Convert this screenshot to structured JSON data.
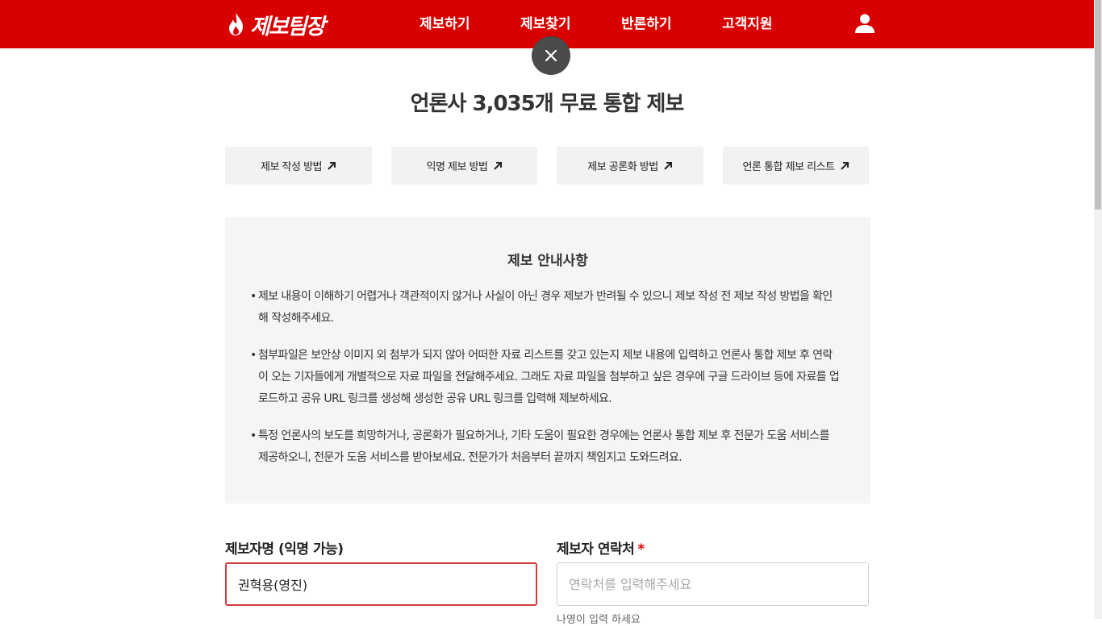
{
  "header": {
    "logo_text": "제보팀장",
    "nav": [
      "제보하기",
      "제보찾기",
      "반론하기",
      "고객지원"
    ],
    "brand_color": "#d90000"
  },
  "close_button": {
    "icon": "close-icon"
  },
  "page_title": "언론사 3,035개 무료 통합 제보",
  "guide_buttons": [
    {
      "label": "제보 작성 방법",
      "icon": "arrow-up-right-icon"
    },
    {
      "label": "익명 제보 방법",
      "icon": "arrow-up-right-icon"
    },
    {
      "label": "제보 공론화 방법",
      "icon": "arrow-up-right-icon"
    },
    {
      "label": "언론 통합 제보 리스트",
      "icon": "arrow-up-right-icon"
    }
  ],
  "notice": {
    "title": "제보 안내사항",
    "items": [
      "제보 내용이 이해하기 어렵거나 객관적이지 않거나 사실이 아닌 경우 제보가 반려될 수 있으니 제보 작성 전 제보 작성 방법을 확인해 작성해주세요.",
      "첨부파일은 보안상 이미지 외 첨부가 되지 않아 어떠한 자료 리스트를 갖고 있는지 제보 내용에 입력하고 언론사 통합 제보 후 연락이 오는 기자들에게 개별적으로 자료 파일을 전달해주세요. 그래도 자료 파일을 첨부하고 싶은 경우에 구글 드라이브 등에 자료를 업로드하고 공유 URL 링크를 생성해 생성한 공유 URL 링크를 입력해 제보하세요.",
      "특정 언론사의 보도를 희망하거나, 공론화가 필요하거나, 기타 도움이 필요한 경우에는 언론사 통합 제보 후 전문가 도움 서비스를 제공하오니, 전문가 도움 서비스를 받아보세요. 전문가가 처음부터 끝까지 책임지고 도와드려요."
    ]
  },
  "form": {
    "name_label": "제보자명 (익명 가능)",
    "name_value": "권혁용(영진)",
    "contact_label": "제보자 연락처",
    "contact_required": "*",
    "contact_placeholder": "연락처를 입력해주세요",
    "contact_helper": "나영이 입력 하세요"
  }
}
